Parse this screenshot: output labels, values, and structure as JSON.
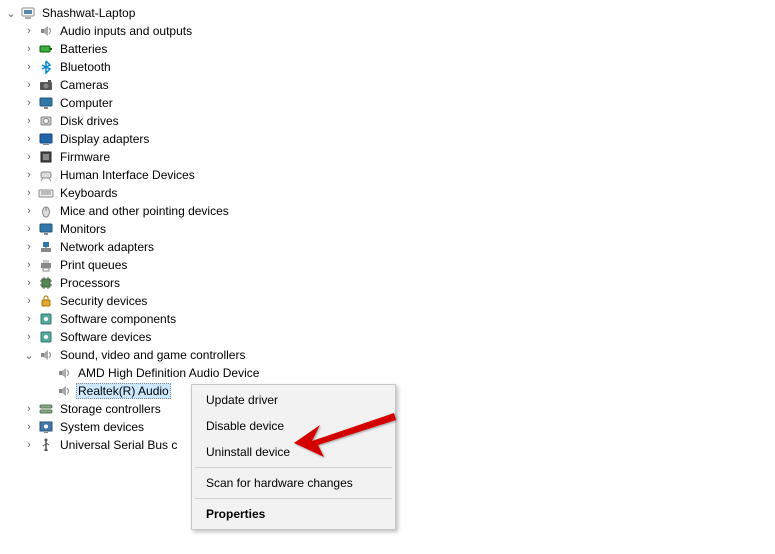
{
  "root": {
    "label": "Shashwat-Laptop",
    "icon": "computer"
  },
  "categories": [
    {
      "label": "Audio inputs and outputs",
      "icon": "audio",
      "expanded": false
    },
    {
      "label": "Batteries",
      "icon": "battery",
      "expanded": false
    },
    {
      "label": "Bluetooth",
      "icon": "bluetooth",
      "expanded": false
    },
    {
      "label": "Cameras",
      "icon": "camera",
      "expanded": false
    },
    {
      "label": "Computer",
      "icon": "monitor",
      "expanded": false
    },
    {
      "label": "Disk drives",
      "icon": "disk",
      "expanded": false
    },
    {
      "label": "Display adapters",
      "icon": "display",
      "expanded": false
    },
    {
      "label": "Firmware",
      "icon": "firmware",
      "expanded": false
    },
    {
      "label": "Human Interface Devices",
      "icon": "hid",
      "expanded": false
    },
    {
      "label": "Keyboards",
      "icon": "keyboard",
      "expanded": false
    },
    {
      "label": "Mice and other pointing devices",
      "icon": "mouse",
      "expanded": false
    },
    {
      "label": "Monitors",
      "icon": "monitor",
      "expanded": false
    },
    {
      "label": "Network adapters",
      "icon": "network",
      "expanded": false
    },
    {
      "label": "Print queues",
      "icon": "printer",
      "expanded": false
    },
    {
      "label": "Processors",
      "icon": "cpu",
      "expanded": false
    },
    {
      "label": "Security devices",
      "icon": "security",
      "expanded": false
    },
    {
      "label": "Software components",
      "icon": "software",
      "expanded": false
    },
    {
      "label": "Software devices",
      "icon": "software",
      "expanded": false
    },
    {
      "label": "Sound, video and game controllers",
      "icon": "audio",
      "expanded": true,
      "children": [
        {
          "label": "AMD High Definition Audio Device",
          "icon": "audio",
          "selected": false
        },
        {
          "label": "Realtek(R) Audio",
          "icon": "audio",
          "selected": true
        }
      ]
    },
    {
      "label": "Storage controllers",
      "icon": "storage",
      "expanded": false
    },
    {
      "label": "System devices",
      "icon": "system",
      "expanded": false
    },
    {
      "label": "Universal Serial Bus controllers",
      "icon": "usb",
      "expanded": false,
      "truncated": "Universal Serial Bus c"
    }
  ],
  "context_menu": {
    "items": [
      {
        "label": "Update driver",
        "sep": false,
        "bold": false
      },
      {
        "label": "Disable device",
        "sep": false,
        "bold": false
      },
      {
        "label": "Uninstall device",
        "sep": false,
        "bold": false
      },
      {
        "sep": true
      },
      {
        "label": "Scan for hardware changes",
        "sep": false,
        "bold": false
      },
      {
        "sep": true
      },
      {
        "label": "Properties",
        "sep": false,
        "bold": true
      }
    ]
  },
  "highlight_target": "Uninstall device"
}
